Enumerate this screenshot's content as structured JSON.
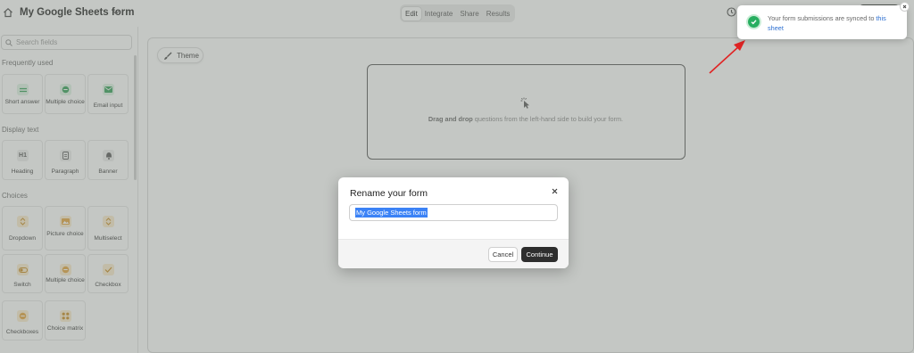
{
  "header": {
    "form_title": "My Google Sheets form",
    "tabs": [
      "Edit",
      "Integrate",
      "Share",
      "Results"
    ],
    "active_tab": "Edit"
  },
  "sidebar": {
    "search_placeholder": "Search fields",
    "sections": [
      {
        "label": "Frequently used",
        "fields": [
          {
            "label": "Short answer",
            "icon": "short-answer-icon"
          },
          {
            "label": "Multiple choice",
            "icon": "multiple-choice-icon"
          },
          {
            "label": "Email input",
            "icon": "email-icon"
          }
        ]
      },
      {
        "label": "Display text",
        "fields": [
          {
            "label": "Heading",
            "icon": "heading-icon",
            "glyph": "H1"
          },
          {
            "label": "Paragraph",
            "icon": "paragraph-icon"
          },
          {
            "label": "Banner",
            "icon": "banner-icon"
          }
        ]
      },
      {
        "label": "Choices",
        "fields": [
          {
            "label": "Dropdown",
            "icon": "dropdown-icon"
          },
          {
            "label": "Picture choice",
            "icon": "picture-choice-icon"
          },
          {
            "label": "Multiselect",
            "icon": "multiselect-icon"
          },
          {
            "label": "Switch",
            "icon": "switch-icon"
          },
          {
            "label": "Multiple choice",
            "icon": "multiple-choice-icon"
          },
          {
            "label": "Checkbox",
            "icon": "checkbox-icon"
          },
          {
            "label": "Checkboxes",
            "icon": "checkboxes-icon"
          },
          {
            "label": "Choice matrix",
            "icon": "choice-matrix-icon"
          }
        ]
      }
    ]
  },
  "canvas": {
    "theme_label": "Theme",
    "dropzone_bold": "Drag and drop",
    "dropzone_rest": " questions from the left-hand side to build your form."
  },
  "modal": {
    "title": "Rename your form",
    "input_value": "My Google Sheets form",
    "cancel_label": "Cancel",
    "continue_label": "Continue"
  },
  "toast": {
    "text": "Your form submissions are synced to ",
    "link": "this sheet"
  },
  "colors": {
    "accent_dark": "#2e2e2e",
    "success": "#27ae60",
    "selection": "#3b82f6",
    "link": "#2c6fd1",
    "annotation_arrow": "#e02424"
  }
}
